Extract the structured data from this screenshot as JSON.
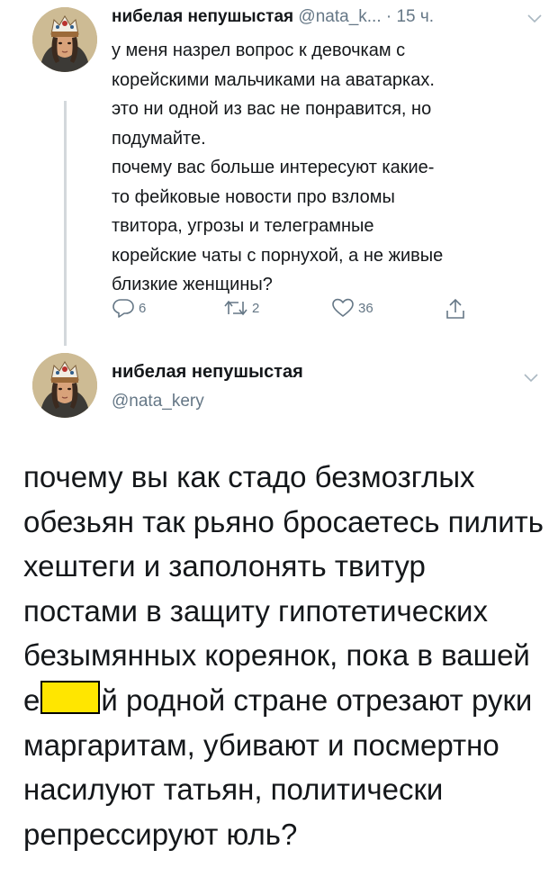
{
  "tweet1": {
    "author_name": "нибелая непушыстая",
    "handle": "@nata_k...",
    "time": "· 15 ч.",
    "body_lines": [
      "у меня назрел вопрос к девочкам с",
      "корейскими мальчиками на аватарках.",
      "это ни одной из вас не понравится, но",
      "подумайте.",
      "почему вас больше интересуют какие-",
      "то фейковые новости про взломы",
      "твитора, угрозы и телеграмные",
      "корейские чаты с порнухой, а не живые",
      "близкие женщины?"
    ],
    "replies": "6",
    "retweets": "2",
    "likes": "36",
    "icons": {
      "reply": "reply-icon",
      "retweet": "retweet-icon",
      "like": "heart-icon",
      "share": "share-icon",
      "menu": "chevron-down-icon"
    }
  },
  "tweet2": {
    "author_name": "нибелая непушыстая",
    "handle": "@nata_kery",
    "body_start": "почему вы как стадо безмозглых обезьян так рьяно бросаетесь пилить хештеги и заполонять твитур постами в защиту гипотетических безымянных кореянок, пока в вашей е",
    "body_end": "й родной стране отрезают руки маргаритам, убивают и посмертно насилуют татьян, политически репрессируют юль?",
    "redaction_color": "#ffe600"
  },
  "colors": {
    "text": "#14171a",
    "secondary": "#657786",
    "thread_line": "#d3d8dc"
  }
}
